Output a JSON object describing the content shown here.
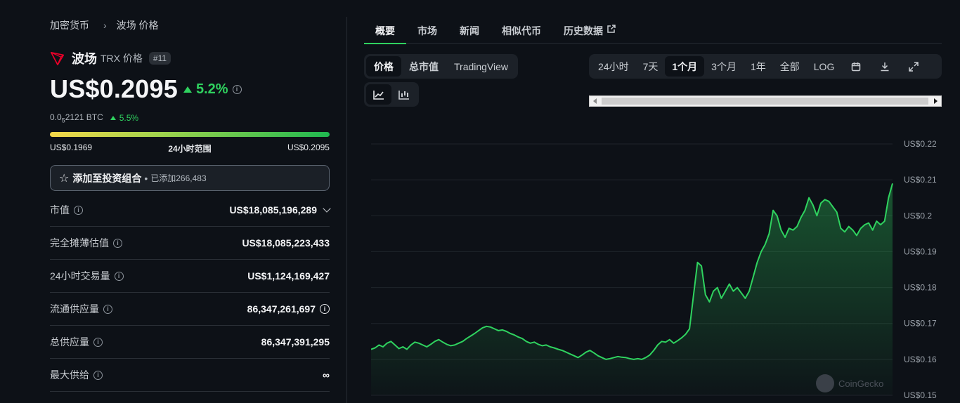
{
  "breadcrumb": {
    "root": "加密货币",
    "current": "波场 价格"
  },
  "coin": {
    "name": "波场",
    "symbol_label": "TRX 价格",
    "rank": "#11",
    "price": "US$0.2095",
    "change_24h": "5.2%",
    "btc_price_prefix": "0.0",
    "btc_price_sub": "5",
    "btc_price_rest": "2121 BTC",
    "btc_change": "5.5%",
    "brand_color": "#eb0029"
  },
  "range_24h": {
    "low": "US$0.1969",
    "label": "24小时范围",
    "high": "US$0.2095"
  },
  "portfolio": {
    "label": "添加至投资组合",
    "added": "已添加266,483"
  },
  "stats": [
    {
      "label": "市值",
      "value": "US$18,085,196,289"
    },
    {
      "label": "完全摊薄估值",
      "value": "US$18,085,223,433"
    },
    {
      "label": "24小时交易量",
      "value": "US$1,124,169,427"
    },
    {
      "label": "流通供应量",
      "value": "86,347,261,697"
    },
    {
      "label": "总供应量",
      "value": "86,347,391,295"
    },
    {
      "label": "最大供给",
      "value": "∞"
    }
  ],
  "tabs": [
    "概要",
    "市场",
    "新闻",
    "相似代币",
    "历史数据"
  ],
  "chart_tabs": [
    "价格",
    "总市值",
    "TradingView"
  ],
  "time_ranges": [
    "24小时",
    "7天",
    "1个月",
    "3个月",
    "1年",
    "全部",
    "LOG"
  ],
  "watermark": "CoinGecko",
  "colors": {
    "accent": "#2fd25f",
    "background": "#0d1117"
  },
  "chart_data": {
    "type": "area",
    "xlabel": "",
    "ylabel": "",
    "ylim": [
      0.15,
      0.22
    ],
    "y_ticks": [
      "US$0.22",
      "US$0.21",
      "US$0.2",
      "US$0.19",
      "US$0.18",
      "US$0.17",
      "US$0.16",
      "US$0.15"
    ],
    "y_tick_values": [
      0.22,
      0.21,
      0.2,
      0.19,
      0.18,
      0.17,
      0.16,
      0.15
    ],
    "grid": true,
    "values": [
      0.1628,
      0.1632,
      0.164,
      0.1635,
      0.1645,
      0.165,
      0.164,
      0.163,
      0.1635,
      0.1628,
      0.164,
      0.1648,
      0.1645,
      0.164,
      0.1635,
      0.1642,
      0.165,
      0.1655,
      0.1648,
      0.1642,
      0.1638,
      0.164,
      0.1645,
      0.165,
      0.1658,
      0.1665,
      0.1672,
      0.168,
      0.1688,
      0.1692,
      0.169,
      0.1685,
      0.168,
      0.1682,
      0.1678,
      0.1672,
      0.1668,
      0.1662,
      0.1658,
      0.165,
      0.1645,
      0.1648,
      0.1642,
      0.1638,
      0.164,
      0.1635,
      0.1632,
      0.1628,
      0.1625,
      0.162,
      0.1615,
      0.161,
      0.1605,
      0.1612,
      0.162,
      0.1625,
      0.1618,
      0.161,
      0.1605,
      0.16,
      0.1602,
      0.1605,
      0.1608,
      0.1606,
      0.1605,
      0.1602,
      0.16,
      0.1602,
      0.16,
      0.1605,
      0.1612,
      0.1625,
      0.164,
      0.165,
      0.1648,
      0.1655,
      0.1645,
      0.1652,
      0.166,
      0.167,
      0.1685,
      0.1778,
      0.187,
      0.186,
      0.178,
      0.176,
      0.179,
      0.18,
      0.177,
      0.179,
      0.181,
      0.179,
      0.18,
      0.1785,
      0.177,
      0.179,
      0.183,
      0.187,
      0.19,
      0.192,
      0.195,
      0.2015,
      0.2,
      0.196,
      0.194,
      0.1965,
      0.196,
      0.197,
      0.1995,
      0.2015,
      0.205,
      0.203,
      0.2,
      0.2035,
      0.2045,
      0.204,
      0.2025,
      0.201,
      0.1965,
      0.1955,
      0.197,
      0.196,
      0.1945,
      0.1965,
      0.1975,
      0.198,
      0.196,
      0.1985,
      0.1975,
      0.1985,
      0.205,
      0.209
    ]
  }
}
